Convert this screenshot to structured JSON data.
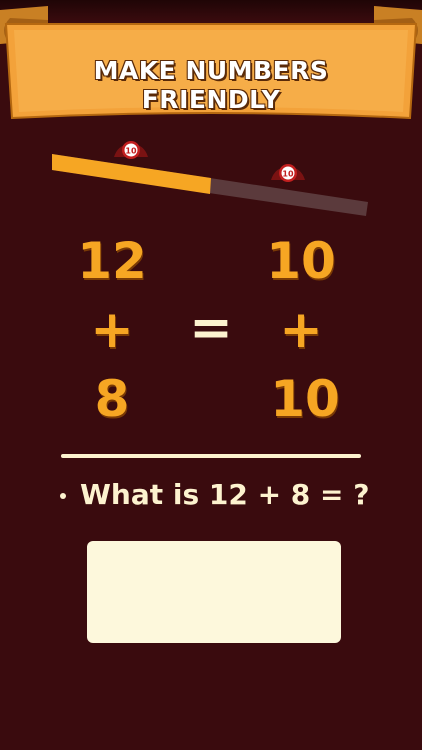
{
  "header": {
    "title": "MAKE NUMBERS FRIENDLY"
  },
  "balance": {
    "left_token": "10",
    "right_token": "10"
  },
  "equation": {
    "left_top": "12",
    "left_op": "+",
    "left_bottom": "8",
    "equals": "=",
    "right_top": "10",
    "right_op": "+",
    "right_bottom": "10"
  },
  "question": {
    "text": "What is 12 + 8 = ?"
  },
  "answer": {
    "value": ""
  },
  "colors": {
    "background": "#3a0b0e",
    "accent": "#f6a623",
    "cream": "#fdf3cf",
    "banner": "#f3a23a"
  }
}
